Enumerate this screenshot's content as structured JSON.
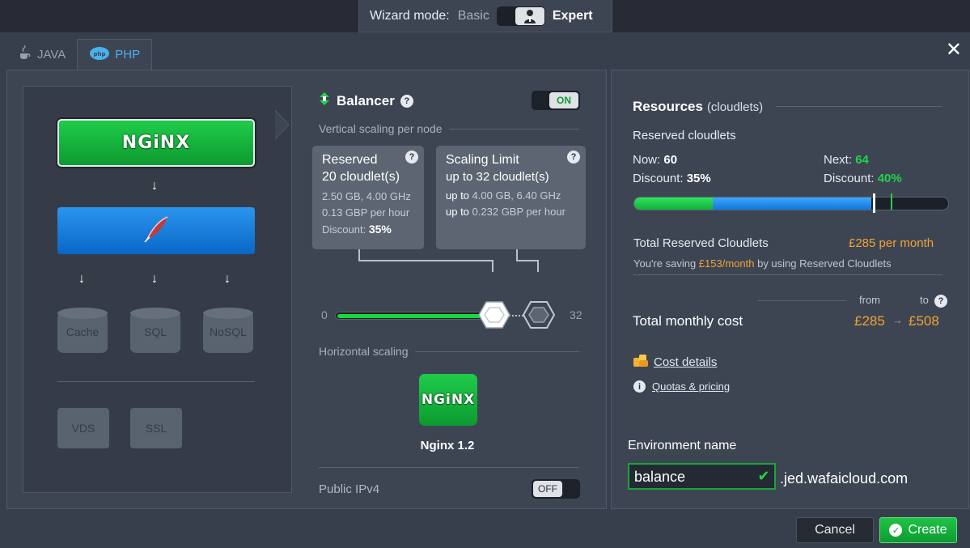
{
  "wizard": {
    "label": "Wizard mode:",
    "basic": "Basic",
    "expert": "Expert",
    "toggle_icon": "user-avatar-icon"
  },
  "tabs": [
    {
      "label": "JAVA",
      "icon": "java-cup-icon",
      "active": false
    },
    {
      "label": "PHP",
      "icon": "php-elephant-icon",
      "active": true
    }
  ],
  "close_glyph": "✕",
  "topology": {
    "balancer_logo": "NGiNX",
    "app_server_icon": "apache-feather-icon",
    "db_buttons": [
      "Cache",
      "SQL",
      "NoSQL"
    ],
    "extra_buttons": [
      "VDS",
      "SSL"
    ]
  },
  "balancer": {
    "title": "Balancer",
    "toggle_state": "ON",
    "vertical_scaling_label": "Vertical scaling per node",
    "reserved": {
      "title": "Reserved",
      "cloudlets": "20 cloudlet(s)",
      "specs": "2.50 GB, 4.00 GHz",
      "price": "0.13 GBP per hour",
      "discount_label": "Discount:",
      "discount_value": "35%"
    },
    "scaling_limit": {
      "title": "Scaling Limit",
      "cloudlets": "up to 32 cloudlet(s)",
      "specs_prefix": "up to",
      "specs": "4.00 GB, 6.40 GHz",
      "price_prefix": "up to",
      "price": "0.232 GBP per hour"
    },
    "slider_min": "0",
    "slider_max": "32",
    "reserved_level": 20,
    "limit_level": 32,
    "horizontal_scaling_label": "Horizontal scaling",
    "node_logo": "NGiNX",
    "node_version": "Nginx 1.2",
    "public_ipv4_label": "Public IPv4",
    "ipv4_state": "OFF"
  },
  "resources": {
    "title": "Resources",
    "unit": "(cloudlets)",
    "reserved_label": "Reserved cloudlets",
    "now_label": "Now:",
    "now_value": "60",
    "next_label": "Next:",
    "next_value": "64",
    "discount_label": "Discount:",
    "now_discount": "35%",
    "next_discount": "40%",
    "total_reserved_label": "Total Reserved Cloudlets",
    "total_reserved_value": "£285 per month",
    "saving_prefix": "You're saving",
    "saving_value": "£153/month",
    "saving_suffix": "by using Reserved Cloudlets",
    "from_label": "from",
    "to_label": "to",
    "total_monthly_label": "Total monthly cost",
    "cost_from": "£285",
    "cost_to": "£508",
    "cost_details": "Cost details",
    "quotas": "Quotas & pricing",
    "env_name_label": "Environment name",
    "env_name_value": "balance",
    "domain_suffix": ".jed.wafaicloud.com"
  },
  "footer": {
    "cancel": "Cancel",
    "create": "Create"
  },
  "colors": {
    "accent_green": "#22d44a",
    "accent_blue": "#4ab1f0",
    "price_orange": "#f2a233"
  }
}
